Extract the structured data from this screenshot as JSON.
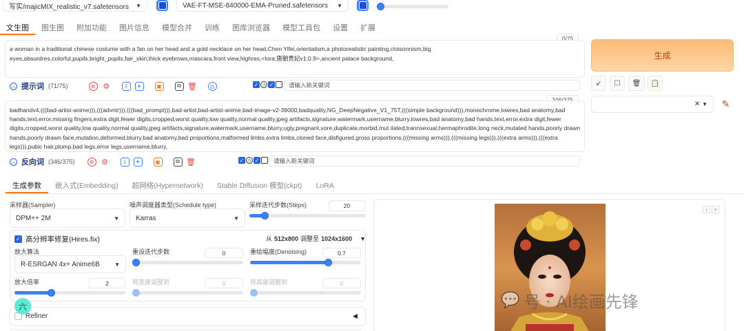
{
  "top": {
    "checkpoint": "写实/majicMIX_realistic_v7.safetensors",
    "vae": "VAE-FT-MSE-840000-EMA-Pruned.safetensors"
  },
  "tabs": [
    "文生图",
    "图生图",
    "附加功能",
    "图片信息",
    "模型合并",
    "训练",
    "图库浏览器",
    "模型工具包",
    "设置",
    "扩展"
  ],
  "prompt": {
    "counter": "0/75",
    "text": "a woman in a traditional chinese costume with a fan on her head and a gold necklace on her head,Chen Yifei,orientalism,a photorealistic painting,cloisonnism,big eyes,absurdres,colorful,pupils,bright_pupils,fair_skin,thick eyebrows,mascara,front view,highres,<lora:唐朝贵妃v1:0.9>,ancient palace background,",
    "label": "提示词",
    "count": "(71/75)",
    "keyword_placeholder": "请输入新关键词"
  },
  "negative": {
    "counter": "346/375",
    "text": "badhandv4,(((bad-artist-anime))),(((advntr))),(((bad_prompt))),bad-artist,bad-artist-anime,bad-image-v2-39000,badquality,NG_DeepNegative_V1_75T,(((simple background))),monochrome,lowres,bad anatomy,bad hands,text,error,missing fingers,extra digit,fewer digits,cropped,worst quality,low quality,normal quality,jpeg artifacts,signature,watermark,username,blurry,lowres,bad anatomy,bad hands,text,error,extra digit,fewer digits,cropped,worst quality,low quality,normal quality,jpeg artifacts,signature,watermark,username,blurry,ugly,pregnant,vore,duplicate,morbid,mut ilated,trannsexual,hermaphrodite,long neck,mutated hands,poorly drawn hands,poorly drawn face,mutation,deformed,blurry,bad anatomy,bad proportions,malformed limbs,extra limbs,cloned face,disfigured,gross proportions,(((missing arms))),(((missing legs))),(((extra arms))),(((extra legs))),pubic hair,plump,bad legs,error legs,username,blurry,",
    "label": "反向词",
    "count": "(346/375)",
    "keyword_placeholder": "请输入新关键词"
  },
  "generate_label": "生成",
  "subtabs": [
    "生成参数",
    "嵌入式(Embedding)",
    "超网络(Hypernetwork)",
    "Stable Diffusion 模型(ckpt)",
    "LoRA"
  ],
  "params": {
    "sampler_label": "采样器(Sampler)",
    "sampler_value": "DPM++ 2M",
    "schedule_label": "噪声调度器类型(Schedule type)",
    "schedule_value": "Karras",
    "steps_label": "采样迭代步数(Steps)",
    "steps_value": "20",
    "steps_fraction": 0.13
  },
  "hires": {
    "title": "高分辨率修复(Hires.fix)",
    "from_label": "从",
    "from_value": "512x800",
    "to_label": "调整至",
    "to_value": "1024x1600",
    "upscaler_label": "放大算法",
    "upscaler_value": "R-ESRGAN 4x+ Anime6B",
    "hires_steps_label": "重设迭代步数",
    "hires_steps_value": "0",
    "hires_steps_fraction": 0.0,
    "denoise_label": "重绘幅度(Denoising)",
    "denoise_value": "0.7",
    "denoise_fraction": 0.7,
    "scale_label": "放大倍率",
    "scale_value": "2",
    "scale_fraction": 0.33,
    "width_label": "将宽度调整到",
    "width_value": "0",
    "height_label": "将高度调整到",
    "height_value": "0"
  },
  "refiner_label": "Refiner",
  "float_badge": "六",
  "watermark": "号 · AI绘画先锋",
  "colors": {
    "accent": "#3b82f6",
    "generate": "#fdba74",
    "active_tab": "#f97316"
  }
}
